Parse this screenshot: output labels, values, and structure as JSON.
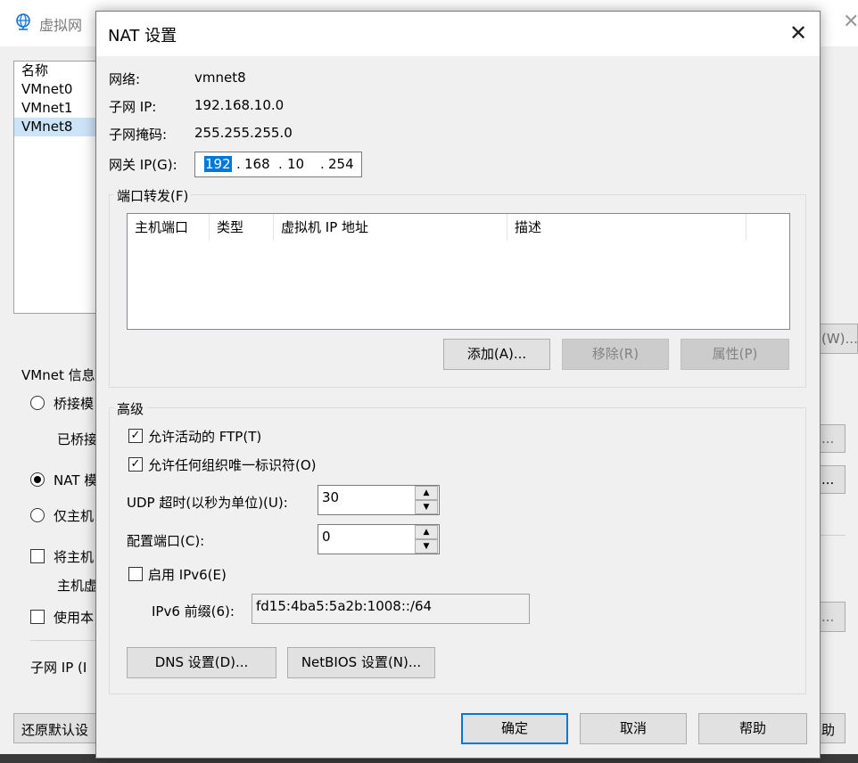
{
  "background_window": {
    "title": "虚拟网",
    "list": [
      "名称",
      "VMnet0",
      "VMnet1",
      "VMnet8"
    ],
    "vmnet_info_label": "VMnet 信息",
    "bridge_label": "桥接模",
    "bridged_to": "已桥接",
    "nat_label": "NAT 模",
    "host_only_label": "仅主机",
    "connect_host": "将主机",
    "host_virtual": "主机虚",
    "use_local": "使用本",
    "subnet_ip_label": "子网 IP (I",
    "restore_defaults": "还原默认设",
    "right_btn_w": "(W)...",
    "right_btn_dots": "...",
    "right_btn_h": "助"
  },
  "dialog": {
    "title": "NAT 设置",
    "network_label": "网络:",
    "network_value": "vmnet8",
    "subnet_ip_label": "子网 IP:",
    "subnet_ip_value": "192.168.10.0",
    "subnet_mask_label": "子网掩码:",
    "subnet_mask_value": "255.255.255.0",
    "gateway_label": "网关 IP(G):",
    "gateway_octets": [
      "192",
      "168",
      "10",
      "254"
    ],
    "port_forwarding": {
      "caption": "端口转发(F)",
      "columns": [
        "主机端口",
        "类型",
        "虚拟机 IP 地址",
        "描述"
      ],
      "rows": [],
      "add_button": "添加(A)...",
      "remove_button": "移除(R)",
      "properties_button": "属性(P)"
    },
    "advanced": {
      "caption": "高级",
      "allow_ftp": "允许活动的 FTP(T)",
      "allow_ftp_checked": true,
      "allow_oui": "允许任何组织唯一标识符(O)",
      "allow_oui_checked": true,
      "udp_timeout_label": "UDP 超时(以秒为单位)(U):",
      "udp_timeout_value": "30",
      "config_port_label": "配置端口(C):",
      "config_port_value": "0",
      "enable_ipv6": "启用 IPv6(E)",
      "enable_ipv6_checked": false,
      "ipv6_prefix_label": "IPv6 前缀(6):",
      "ipv6_prefix_value": "fd15:4ba5:5a2b:1008::/64",
      "dns_button": "DNS 设置(D)...",
      "netbios_button": "NetBIOS 设置(N)..."
    },
    "ok_button": "确定",
    "cancel_button": "取消",
    "help_button": "帮助"
  },
  "colors": {
    "accent": "#0078d7",
    "selection": "#cce4f7"
  },
  "icons": {
    "window_icon": "globe-icon",
    "close": "close-icon",
    "check": "check-icon",
    "spin_up": "chevron-up-icon",
    "spin_down": "chevron-down-icon"
  }
}
